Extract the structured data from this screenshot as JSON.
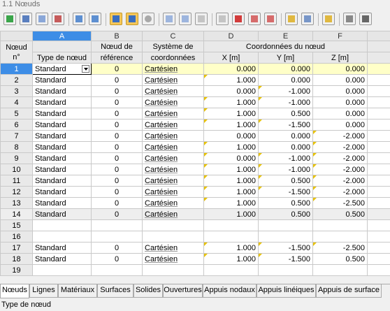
{
  "window": {
    "title": "1.1 Nœuds"
  },
  "columns": {
    "letters": [
      "A",
      "B",
      "C",
      "D",
      "E",
      "F"
    ],
    "row_header_top": "Nœud",
    "row_header_bottom": "n°",
    "type_label": "Type de nœud",
    "ref_top": "Nœud de",
    "ref_bottom": "référence",
    "sys_top": "Système de",
    "sys_bottom": "coordonnées",
    "coords_group": "Coordonnées du nœud",
    "x_label": "X [m]",
    "y_label": "Y [m]",
    "z_label": "Z [m]"
  },
  "rows": [
    {
      "n": "1",
      "type": "Standard",
      "ref": "0",
      "sys": "Cartésien",
      "x": "0.000",
      "y": "0.000",
      "z": "0.000"
    },
    {
      "n": "2",
      "type": "Standard",
      "ref": "0",
      "sys": "Cartésien",
      "x": "1.000",
      "y": "0.000",
      "z": "0.000"
    },
    {
      "n": "3",
      "type": "Standard",
      "ref": "0",
      "sys": "Cartésien",
      "x": "0.000",
      "y": "-1.000",
      "z": "0.000"
    },
    {
      "n": "4",
      "type": "Standard",
      "ref": "0",
      "sys": "Cartésien",
      "x": "1.000",
      "y": "-1.000",
      "z": "0.000"
    },
    {
      "n": "5",
      "type": "Standard",
      "ref": "0",
      "sys": "Cartésien",
      "x": "1.000",
      "y": "0.500",
      "z": "0.000"
    },
    {
      "n": "6",
      "type": "Standard",
      "ref": "0",
      "sys": "Cartésien",
      "x": "1.000",
      "y": "-1.500",
      "z": "0.000"
    },
    {
      "n": "7",
      "type": "Standard",
      "ref": "0",
      "sys": "Cartésien",
      "x": "0.000",
      "y": "0.000",
      "z": "-2.000"
    },
    {
      "n": "8",
      "type": "Standard",
      "ref": "0",
      "sys": "Cartésien",
      "x": "1.000",
      "y": "0.000",
      "z": "-2.000"
    },
    {
      "n": "9",
      "type": "Standard",
      "ref": "0",
      "sys": "Cartésien",
      "x": "0.000",
      "y": "-1.000",
      "z": "-2.000"
    },
    {
      "n": "10",
      "type": "Standard",
      "ref": "0",
      "sys": "Cartésien",
      "x": "1.000",
      "y": "-1.000",
      "z": "-2.000"
    },
    {
      "n": "11",
      "type": "Standard",
      "ref": "0",
      "sys": "Cartésien",
      "x": "1.000",
      "y": "0.500",
      "z": "-2.000"
    },
    {
      "n": "12",
      "type": "Standard",
      "ref": "0",
      "sys": "Cartésien",
      "x": "1.000",
      "y": "-1.500",
      "z": "-2.000"
    },
    {
      "n": "13",
      "type": "Standard",
      "ref": "0",
      "sys": "Cartésien",
      "x": "1.000",
      "y": "0.500",
      "z": "-2.500"
    },
    {
      "n": "14",
      "type": "Standard",
      "ref": "0",
      "sys": "Cartésien",
      "x": "1.000",
      "y": "0.500",
      "z": "0.500"
    },
    {
      "n": "15",
      "type": "",
      "ref": "",
      "sys": "",
      "x": "",
      "y": "",
      "z": ""
    },
    {
      "n": "16",
      "type": "",
      "ref": "",
      "sys": "",
      "x": "",
      "y": "",
      "z": ""
    },
    {
      "n": "17",
      "type": "Standard",
      "ref": "0",
      "sys": "Cartésien",
      "x": "1.000",
      "y": "-1.500",
      "z": "-2.500"
    },
    {
      "n": "18",
      "type": "Standard",
      "ref": "0",
      "sys": "Cartésien",
      "x": "1.000",
      "y": "-1.500",
      "z": "0.500"
    },
    {
      "n": "19",
      "type": "",
      "ref": "",
      "sys": "",
      "x": "",
      "y": "",
      "z": ""
    }
  ],
  "tabs": [
    "Nœuds",
    "Lignes",
    "Matériaux",
    "Surfaces",
    "Solides",
    "Ouvertures",
    "Appuis nodaux",
    "Appuis linéiques",
    "Appuis de surface"
  ],
  "active_tab": "Nœuds",
  "status": {
    "text": "Type de nœud"
  },
  "toolbar": {
    "icons": [
      "table-icon",
      "insert-row-icon",
      "copy-row-icon",
      "delete-row-icon",
      "import-icon",
      "export-icon",
      "select-left-icon",
      "select-right-icon",
      "refresh-icon",
      "prev-icon",
      "next-icon",
      "filter-icon",
      "clear-icon",
      "delete-icon",
      "move-left-icon",
      "move-right-icon",
      "grid-icon",
      "columns-icon",
      "edit-icon",
      "settings-icon",
      "options-icon"
    ]
  },
  "colors": {
    "accent": "#3d8de6",
    "highlight_row": "#ffffc8",
    "flag": "#e8c200"
  }
}
